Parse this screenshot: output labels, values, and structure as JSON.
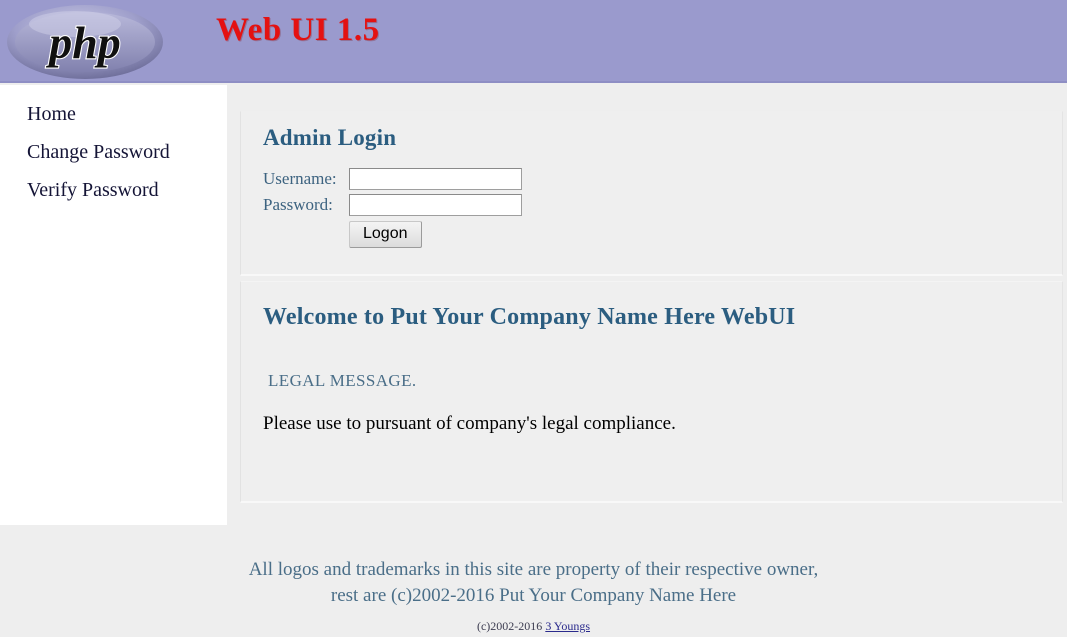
{
  "header": {
    "logo_text": "php",
    "logo_name": "php-logo",
    "title": "Web UI 1.5",
    "background_color": "#9a9acd",
    "title_color": "#e41111"
  },
  "sidebar": {
    "items": [
      {
        "label": "Home",
        "name": "sidebar-item-home"
      },
      {
        "label": "Change Password",
        "name": "sidebar-item-change-password"
      },
      {
        "label": "Verify Password",
        "name": "sidebar-item-verify-password"
      }
    ]
  },
  "login_panel": {
    "heading": "Admin Login",
    "username_label": "Username:",
    "username_value": "",
    "username_placeholder": "",
    "password_label": "Password:",
    "password_value": "",
    "password_placeholder": "",
    "submit_label": "Logon",
    "heading_color": "#2b5d80"
  },
  "welcome_panel": {
    "heading": "Welcome to Put Your Company Name Here WebUI",
    "legal_title": "LEGAL MESSAGE.",
    "legal_body": "Please use to pursuant of company's legal compliance."
  },
  "footer": {
    "line1": "All logos and trademarks in this site are property of their respective owner,",
    "line2": "rest are (c)2002-2016 Put Your Company Name Here",
    "copyright_prefix": "(c)2002-2016 ",
    "copyright_link": "3 Youngs"
  }
}
